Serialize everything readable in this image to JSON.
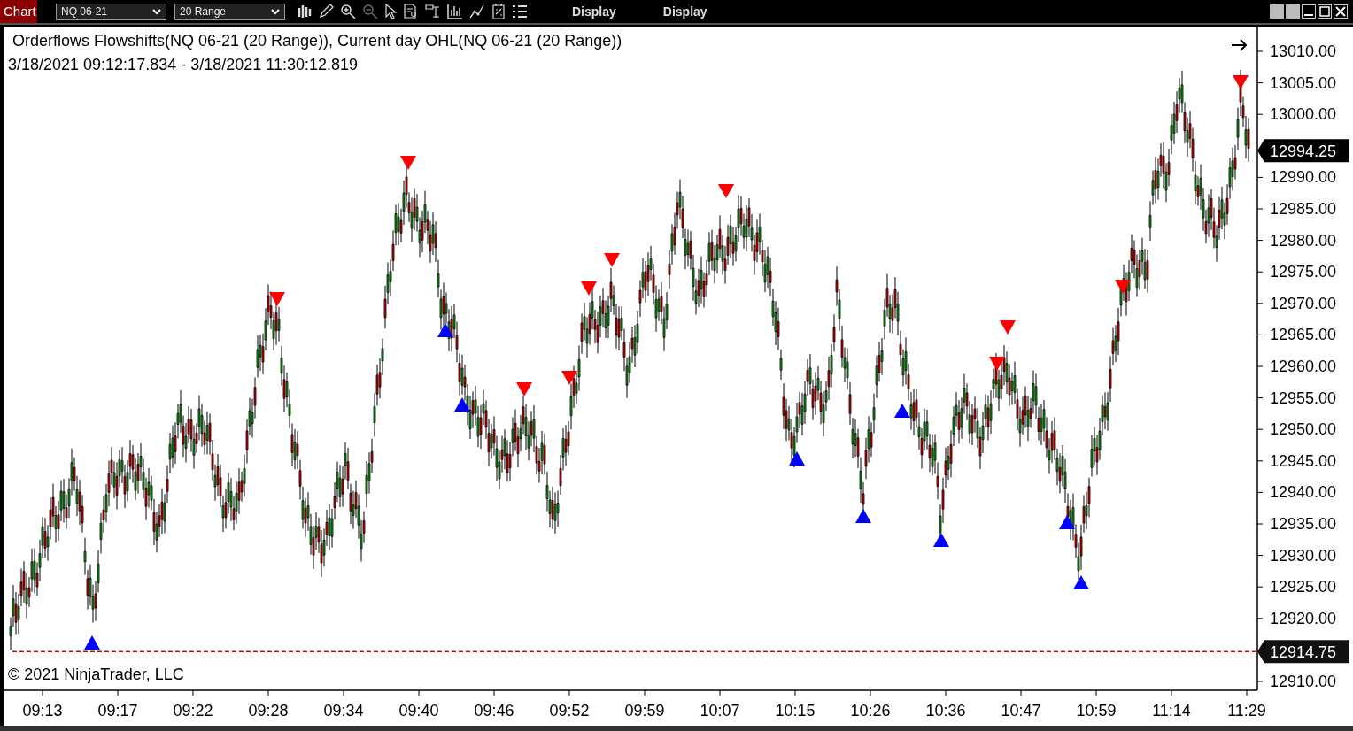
{
  "toolbar": {
    "tab": "Chart",
    "instrument": "NQ 06-21",
    "interval": "20 Range",
    "menus": [
      "Display",
      "Display"
    ]
  },
  "chart": {
    "legend": "Orderflows Flowshifts(NQ 06-21 (20 Range)), Current day OHL(NQ 06-21 (20 Range))",
    "date_range": "3/18/2021 09:12:17.834 - 3/18/2021 11:30:12.819",
    "copyright": "© 2021 NinjaTrader, LLC",
    "y_ticks": [
      "13010.00",
      "13005.00",
      "13000.00",
      "12990.00",
      "12985.00",
      "12980.00",
      "12975.00",
      "12970.00",
      "12965.00",
      "12960.00",
      "12955.00",
      "12950.00",
      "12945.00",
      "12940.00",
      "12935.00",
      "12930.00",
      "12925.00",
      "12920.00",
      "12910.00"
    ],
    "x_ticks": [
      "09:13",
      "09:17",
      "09:22",
      "09:28",
      "09:34",
      "09:40",
      "09:46",
      "09:52",
      "09:59",
      "10:07",
      "10:15",
      "10:26",
      "10:36",
      "10:47",
      "10:59",
      "11:14",
      "11:29"
    ],
    "price_labels": [
      {
        "kind": "last",
        "text": "12994.25"
      },
      {
        "kind": "low",
        "text": "12914.75"
      }
    ]
  }
}
